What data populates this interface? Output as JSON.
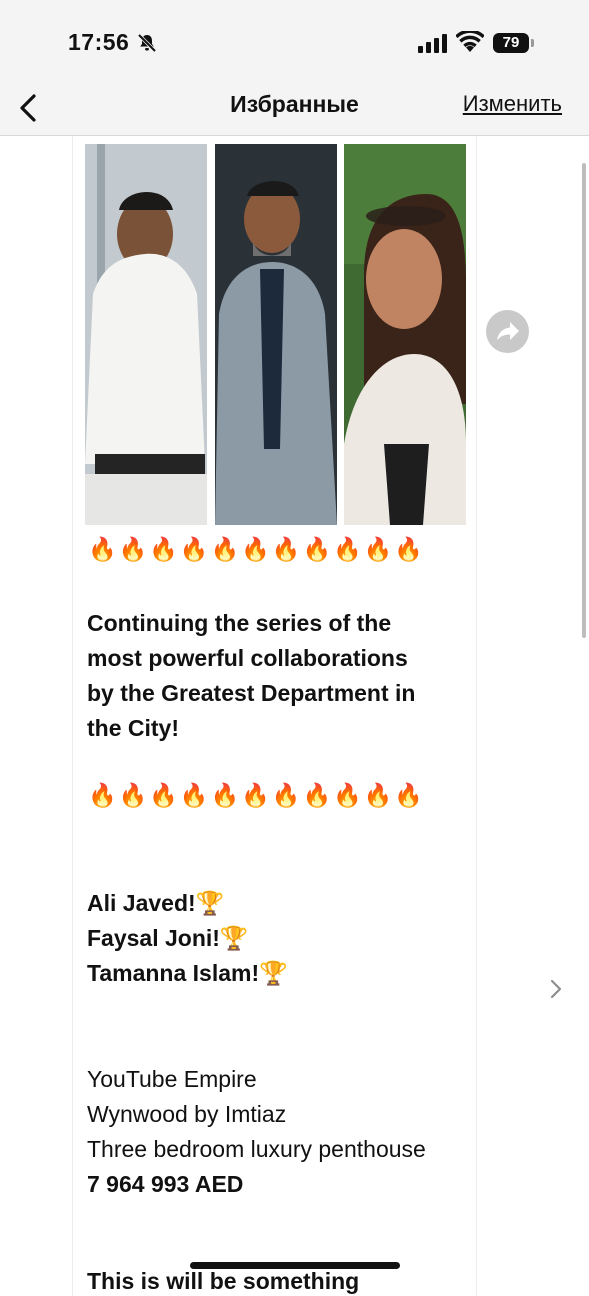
{
  "status_bar": {
    "time": "17:56",
    "battery": "79"
  },
  "nav": {
    "title": "Избранные",
    "edit_label": "Изменить"
  },
  "post": {
    "emoji_row_top": "🔥🔥🔥🔥🔥🔥🔥🔥🔥🔥🔥",
    "headline_lines": [
      "Continuing the series of the",
      "most powerful collaborations",
      "by the Greatest Department in",
      "the City!"
    ],
    "emoji_row_bottom": "🔥🔥🔥🔥🔥🔥🔥🔥🔥🔥🔥",
    "people": [
      "Ali Javed!🏆",
      "Faysal Joni!🏆",
      "Tamanna Islam!🏆"
    ],
    "details": [
      "YouTube Empire",
      "Wynwood by Imtiaz",
      "Three bedroom luxury penthouse"
    ],
    "price": "7 964 993 AED",
    "cut_off_text": "This is will be something"
  },
  "icons": {
    "back": "chevron-left-icon",
    "share": "share-arrow-icon",
    "next": "chevron-right-icon",
    "mute": "bell-slash-icon",
    "signal": "cellular-signal-icon",
    "wifi": "wifi-icon"
  }
}
